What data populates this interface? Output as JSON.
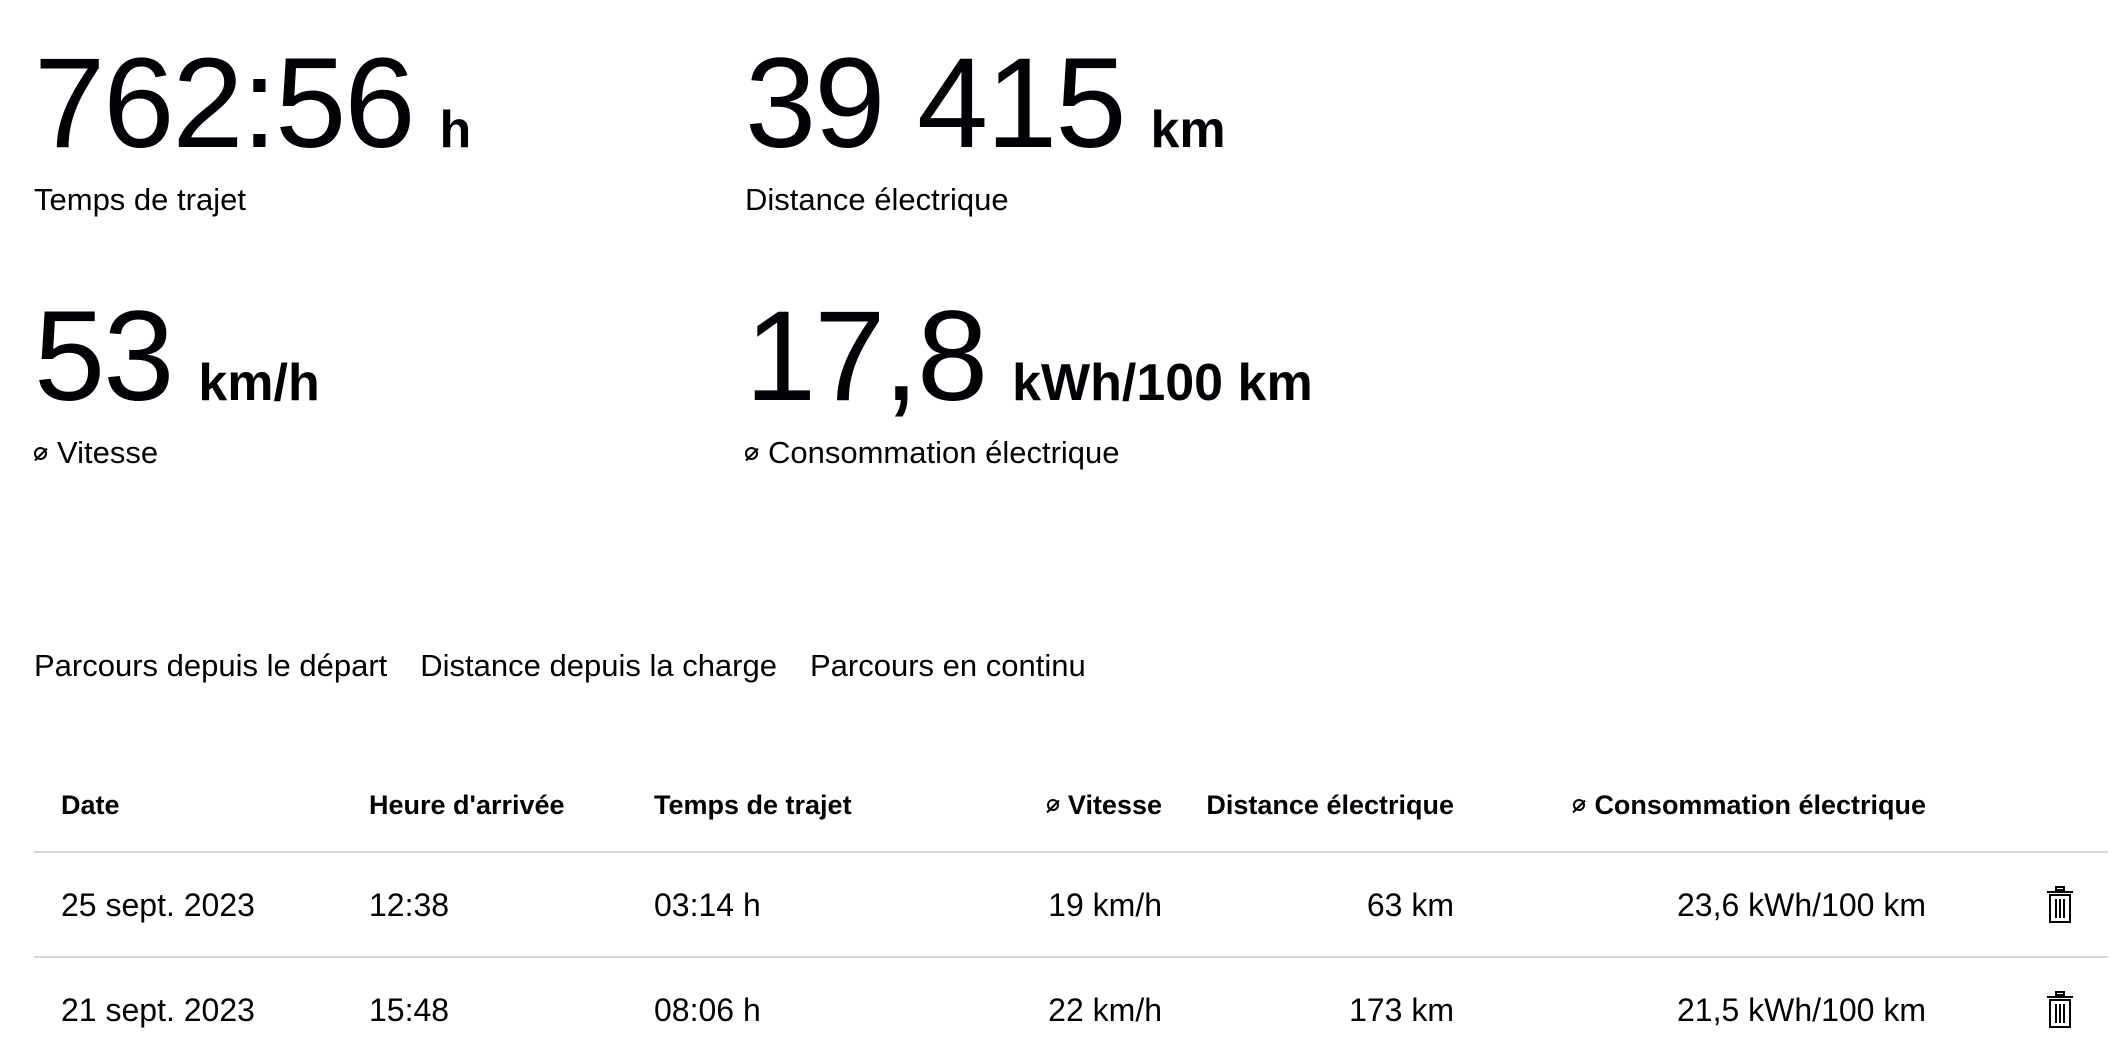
{
  "summary": {
    "travel_time": {
      "value": "762:56",
      "unit": "h",
      "label": "Temps de trajet"
    },
    "electric_distance": {
      "value": "39 415",
      "unit": "km",
      "label": "Distance électrique"
    },
    "avg_speed": {
      "value": "53",
      "unit": "km/h",
      "label": "Vitesse",
      "icon": "average-icon"
    },
    "avg_consumption": {
      "value": "17,8",
      "unit": "kWh/100 km",
      "label": "Consommation électrique",
      "icon": "average-icon"
    }
  },
  "tabs": [
    {
      "label": "Parcours depuis le départ"
    },
    {
      "label": "Distance depuis la charge"
    },
    {
      "label": "Parcours en continu"
    }
  ],
  "table": {
    "headers": {
      "date": "Date",
      "arrival": "Heure d'arrivée",
      "travel_time": "Temps de trajet",
      "speed": "Vitesse",
      "distance": "Distance électrique",
      "consumption": "Consommation électrique"
    },
    "rows": [
      {
        "date": "25 sept. 2023",
        "arrival": "12:38",
        "travel_time": "03:14 h",
        "speed": "19 km/h",
        "distance": "63 km",
        "consumption": "23,6 kWh/100 km",
        "action_icon": "trash-icon"
      },
      {
        "date": "21 sept. 2023",
        "arrival": "15:48",
        "travel_time": "08:06 h",
        "speed": "22 km/h",
        "distance": "173 km",
        "consumption": "21,5 kWh/100 km",
        "action_icon": "trash-icon"
      }
    ]
  },
  "colors": {
    "text": "#010205",
    "divider": "#d8d8db",
    "background": "#ffffff"
  }
}
